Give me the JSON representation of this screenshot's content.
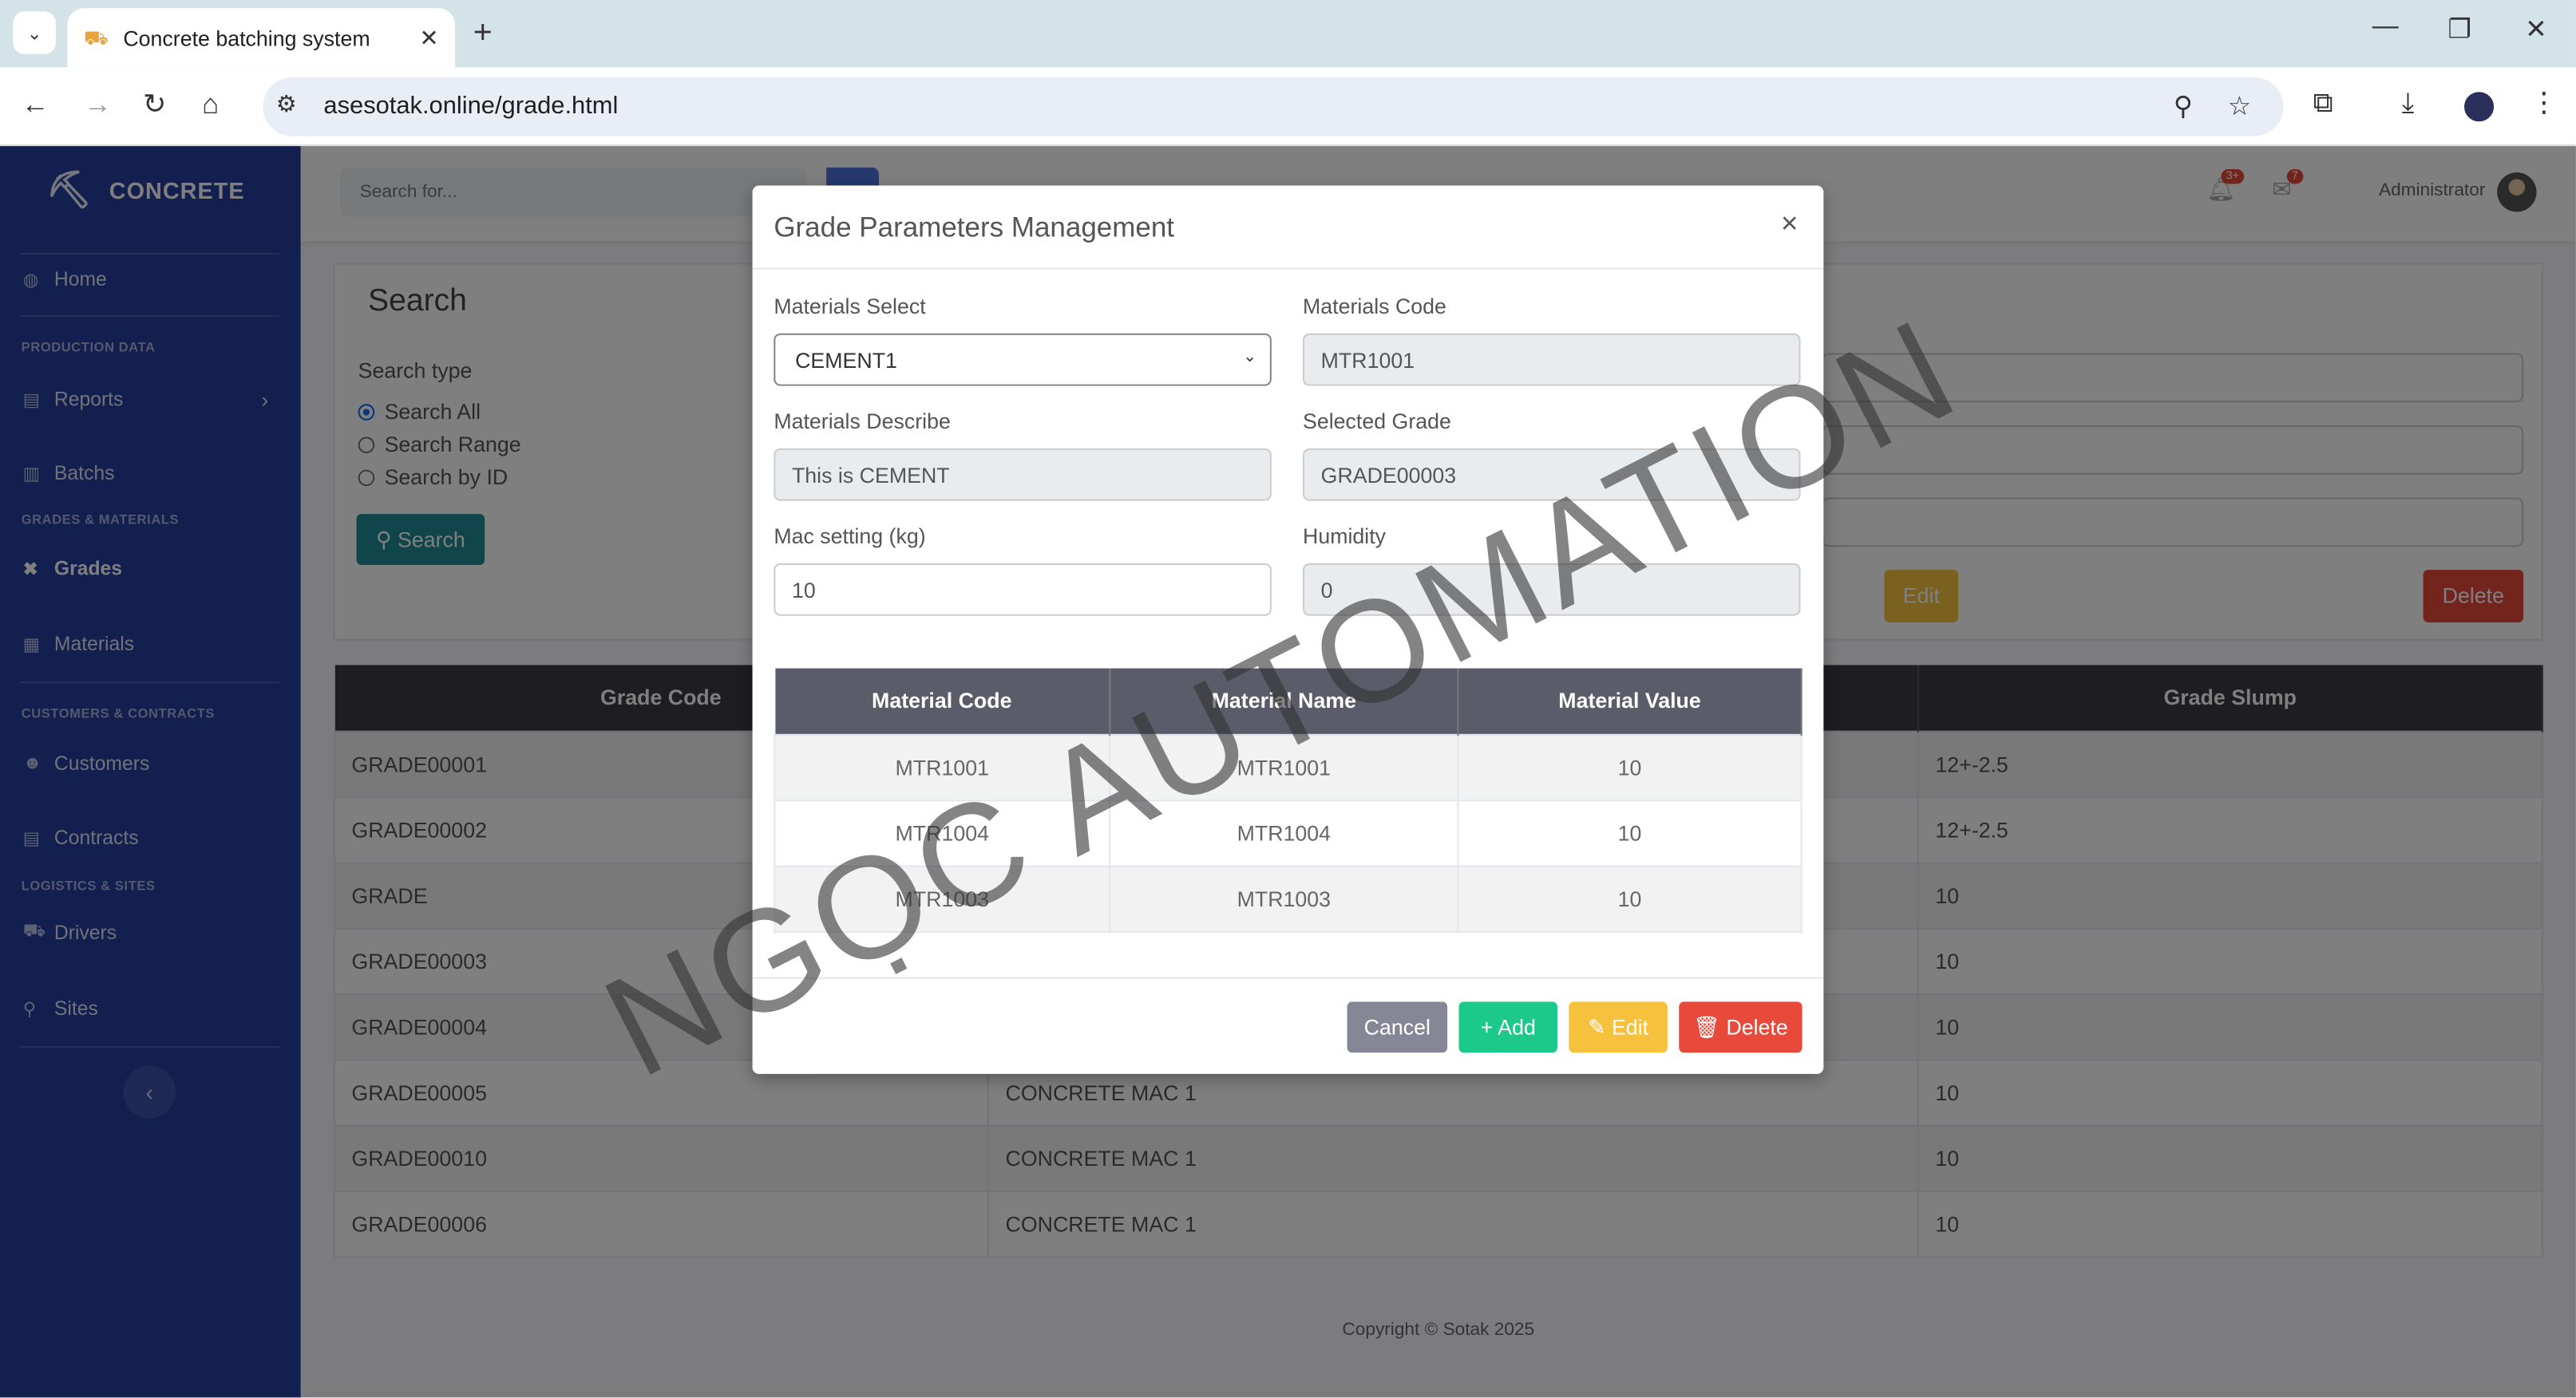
{
  "browser": {
    "tab_title": "Concrete batching system",
    "url": "asesotak.online/grade.html"
  },
  "sidebar": {
    "brand": "CONCRETE",
    "items": [
      {
        "label": "Home",
        "icon": "palette-icon"
      },
      {
        "heading": "PRODUCTION DATA"
      },
      {
        "label": "Reports",
        "icon": "file-icon"
      },
      {
        "label": "Batchs",
        "icon": "chart-icon"
      },
      {
        "heading": "GRADES & MATERIALS"
      },
      {
        "label": "Grades",
        "icon": "tools-icon"
      },
      {
        "label": "Materials",
        "icon": "boxes-icon"
      },
      {
        "heading": "CUSTOMERS & CONTRACTS"
      },
      {
        "label": "Customers",
        "icon": "users-icon"
      },
      {
        "label": "Contracts",
        "icon": "file-icon"
      },
      {
        "heading": "LOGISTICS & SITES"
      },
      {
        "label": "Drivers",
        "icon": "truck-icon"
      },
      {
        "label": "Sites",
        "icon": "map-marker-icon"
      }
    ]
  },
  "topbar": {
    "search_placeholder": "Search for...",
    "alerts_badge": "3+",
    "messages_badge": "7",
    "user": "Administrator"
  },
  "search_card": {
    "title": "Search",
    "search_type_label": "Search type",
    "options": [
      "Search All",
      "Search Range",
      "Search by ID"
    ],
    "selected": "Search All",
    "search_button": "Search",
    "edit_button": "Edit",
    "delete_button": "Delete"
  },
  "grades_table": {
    "headers": [
      "Grade Code",
      "",
      "Grade Slump"
    ],
    "rows": [
      [
        "GRADE00001",
        "",
        "12+-2.5"
      ],
      [
        "GRADE00002",
        "",
        "12+-2.5"
      ],
      [
        "GRADE",
        "",
        "10"
      ],
      [
        "GRADE00003",
        "",
        "10"
      ],
      [
        "GRADE00004",
        "",
        "10"
      ],
      [
        "GRADE00005",
        "CONCRETE MAC 1",
        "10"
      ],
      [
        "GRADE00010",
        "CONCRETE MAC 1",
        "10"
      ],
      [
        "GRADE00006",
        "CONCRETE MAC 1",
        "10"
      ]
    ]
  },
  "footer": {
    "copyright": "Copyright © Sotak 2025"
  },
  "modal": {
    "title": "Grade Parameters Management",
    "close": "×",
    "materials_select_label": "Materials Select",
    "materials_select_value": "CEMENT1",
    "materials_code_label": "Materials Code",
    "materials_code_value": "MTR1001",
    "materials_describe_label": "Materials Describe",
    "materials_describe_value": "This is CEMENT",
    "selected_grade_label": "Selected Grade",
    "selected_grade_value": "GRADE00003",
    "mac_setting_label": "Mac setting (kg)",
    "mac_setting_value": "10",
    "humidity_label": "Humidity",
    "humidity_value": "0",
    "table_headers": [
      "Material Code",
      "Material Name",
      "Material Value"
    ],
    "table_rows": [
      [
        "MTR1001",
        "MTR1001",
        "10"
      ],
      [
        "MTR1004",
        "MTR1004",
        "10"
      ],
      [
        "MTR1003",
        "MTR1003",
        "10"
      ]
    ],
    "buttons": {
      "cancel": "Cancel",
      "add": "Add",
      "edit": "Edit",
      "delete": "Delete"
    }
  },
  "watermark": "NGỌC AUTOMATION",
  "colors": {
    "sidebar": "#273f9e",
    "primary": "#4e73df",
    "success": "#1cc88a",
    "warning": "#f6c23e",
    "danger": "#e74a3b",
    "secondary": "#858796"
  }
}
